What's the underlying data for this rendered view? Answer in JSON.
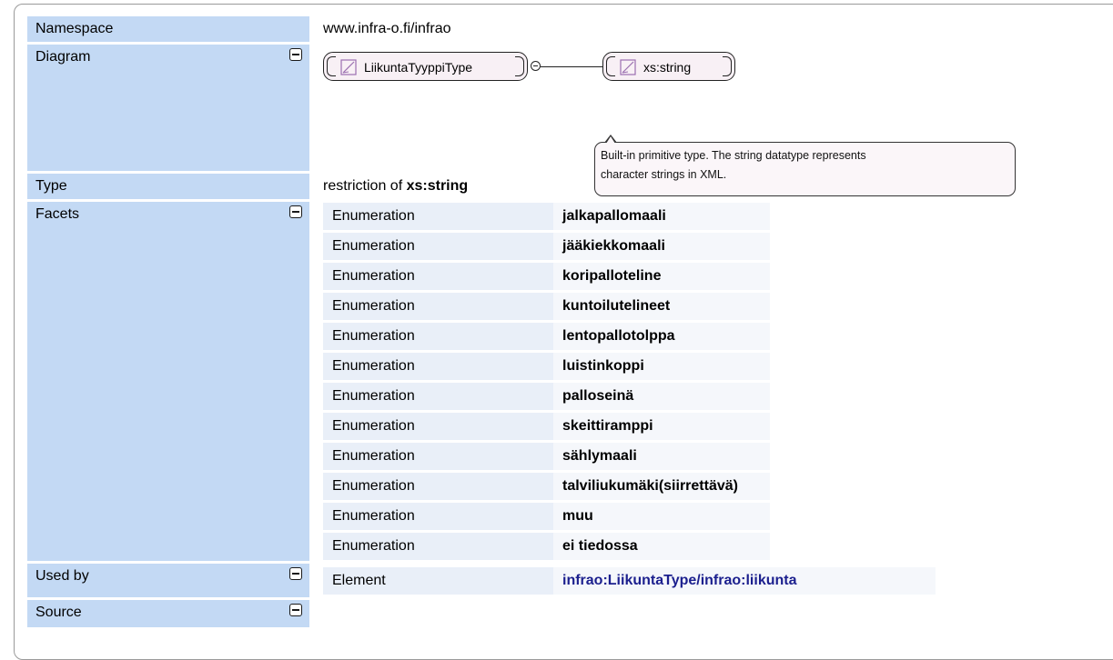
{
  "rows": {
    "namespace": {
      "label": "Namespace",
      "value": "www.infra-o.fi/infrao"
    },
    "diagram": {
      "label": "Diagram",
      "source_type": "LiikuntaTyyppiType",
      "base_type": "xs:string",
      "tooltip_line1": "Built-in primitive type. The string datatype represents",
      "tooltip_line2": "character strings in XML."
    },
    "type": {
      "label": "Type",
      "prefix": "restriction of ",
      "base": "xs:string"
    },
    "facets": {
      "label": "Facets",
      "items": [
        {
          "kind": "Enumeration",
          "value": "jalkapallomaali"
        },
        {
          "kind": "Enumeration",
          "value": "jääkiekkomaali"
        },
        {
          "kind": "Enumeration",
          "value": "koripalloteline"
        },
        {
          "kind": "Enumeration",
          "value": "kuntoilutelineet"
        },
        {
          "kind": "Enumeration",
          "value": "lentopallotolppa"
        },
        {
          "kind": "Enumeration",
          "value": "luistinkoppi"
        },
        {
          "kind": "Enumeration",
          "value": "palloseinä"
        },
        {
          "kind": "Enumeration",
          "value": "skeittiramppi"
        },
        {
          "kind": "Enumeration",
          "value": "sählymaali"
        },
        {
          "kind": "Enumeration",
          "value": "talviliukumäki(siirrettävä)"
        },
        {
          "kind": "Enumeration",
          "value": "muu"
        },
        {
          "kind": "Enumeration",
          "value": "ei tiedossa"
        }
      ]
    },
    "used_by": {
      "label": "Used by",
      "kind": "Element",
      "value": "infrao:LiikuntaType/infrao:liikunta"
    },
    "source": {
      "label": "Source"
    }
  },
  "icons": {
    "collapse": "collapse-minus-icon",
    "simple_type": "simple-type-icon"
  },
  "colors": {
    "label_bg": "#c3d9f4",
    "facet_key_bg": "#e9eff8",
    "facet_val_bg": "#f5f7fb",
    "link": "#1b1f8e"
  }
}
